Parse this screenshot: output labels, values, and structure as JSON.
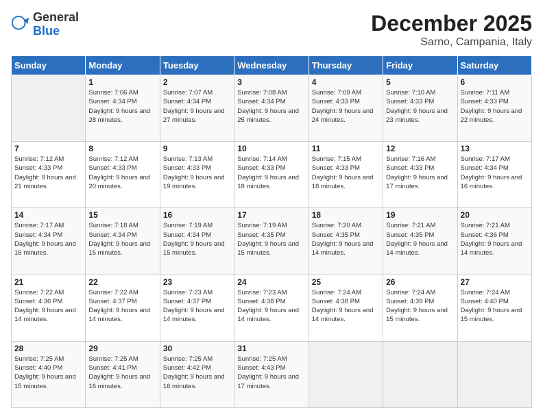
{
  "logo": {
    "general": "General",
    "blue": "Blue"
  },
  "title": "December 2025",
  "subtitle": "Sarno, Campania, Italy",
  "days_header": [
    "Sunday",
    "Monday",
    "Tuesday",
    "Wednesday",
    "Thursday",
    "Friday",
    "Saturday"
  ],
  "weeks": [
    [
      {
        "day": "",
        "sunrise": "",
        "sunset": "",
        "daylight": ""
      },
      {
        "day": "1",
        "sunrise": "Sunrise: 7:06 AM",
        "sunset": "Sunset: 4:34 PM",
        "daylight": "Daylight: 9 hours and 28 minutes."
      },
      {
        "day": "2",
        "sunrise": "Sunrise: 7:07 AM",
        "sunset": "Sunset: 4:34 PM",
        "daylight": "Daylight: 9 hours and 27 minutes."
      },
      {
        "day": "3",
        "sunrise": "Sunrise: 7:08 AM",
        "sunset": "Sunset: 4:34 PM",
        "daylight": "Daylight: 9 hours and 25 minutes."
      },
      {
        "day": "4",
        "sunrise": "Sunrise: 7:09 AM",
        "sunset": "Sunset: 4:33 PM",
        "daylight": "Daylight: 9 hours and 24 minutes."
      },
      {
        "day": "5",
        "sunrise": "Sunrise: 7:10 AM",
        "sunset": "Sunset: 4:33 PM",
        "daylight": "Daylight: 9 hours and 23 minutes."
      },
      {
        "day": "6",
        "sunrise": "Sunrise: 7:11 AM",
        "sunset": "Sunset: 4:33 PM",
        "daylight": "Daylight: 9 hours and 22 minutes."
      }
    ],
    [
      {
        "day": "7",
        "sunrise": "Sunrise: 7:12 AM",
        "sunset": "Sunset: 4:33 PM",
        "daylight": "Daylight: 9 hours and 21 minutes."
      },
      {
        "day": "8",
        "sunrise": "Sunrise: 7:12 AM",
        "sunset": "Sunset: 4:33 PM",
        "daylight": "Daylight: 9 hours and 20 minutes."
      },
      {
        "day": "9",
        "sunrise": "Sunrise: 7:13 AM",
        "sunset": "Sunset: 4:33 PM",
        "daylight": "Daylight: 9 hours and 19 minutes."
      },
      {
        "day": "10",
        "sunrise": "Sunrise: 7:14 AM",
        "sunset": "Sunset: 4:33 PM",
        "daylight": "Daylight: 9 hours and 18 minutes."
      },
      {
        "day": "11",
        "sunrise": "Sunrise: 7:15 AM",
        "sunset": "Sunset: 4:33 PM",
        "daylight": "Daylight: 9 hours and 18 minutes."
      },
      {
        "day": "12",
        "sunrise": "Sunrise: 7:16 AM",
        "sunset": "Sunset: 4:33 PM",
        "daylight": "Daylight: 9 hours and 17 minutes."
      },
      {
        "day": "13",
        "sunrise": "Sunrise: 7:17 AM",
        "sunset": "Sunset: 4:34 PM",
        "daylight": "Daylight: 9 hours and 16 minutes."
      }
    ],
    [
      {
        "day": "14",
        "sunrise": "Sunrise: 7:17 AM",
        "sunset": "Sunset: 4:34 PM",
        "daylight": "Daylight: 9 hours and 16 minutes."
      },
      {
        "day": "15",
        "sunrise": "Sunrise: 7:18 AM",
        "sunset": "Sunset: 4:34 PM",
        "daylight": "Daylight: 9 hours and 15 minutes."
      },
      {
        "day": "16",
        "sunrise": "Sunrise: 7:19 AM",
        "sunset": "Sunset: 4:34 PM",
        "daylight": "Daylight: 9 hours and 15 minutes."
      },
      {
        "day": "17",
        "sunrise": "Sunrise: 7:19 AM",
        "sunset": "Sunset: 4:35 PM",
        "daylight": "Daylight: 9 hours and 15 minutes."
      },
      {
        "day": "18",
        "sunrise": "Sunrise: 7:20 AM",
        "sunset": "Sunset: 4:35 PM",
        "daylight": "Daylight: 9 hours and 14 minutes."
      },
      {
        "day": "19",
        "sunrise": "Sunrise: 7:21 AM",
        "sunset": "Sunset: 4:35 PM",
        "daylight": "Daylight: 9 hours and 14 minutes."
      },
      {
        "day": "20",
        "sunrise": "Sunrise: 7:21 AM",
        "sunset": "Sunset: 4:36 PM",
        "daylight": "Daylight: 9 hours and 14 minutes."
      }
    ],
    [
      {
        "day": "21",
        "sunrise": "Sunrise: 7:22 AM",
        "sunset": "Sunset: 4:36 PM",
        "daylight": "Daylight: 9 hours and 14 minutes."
      },
      {
        "day": "22",
        "sunrise": "Sunrise: 7:22 AM",
        "sunset": "Sunset: 4:37 PM",
        "daylight": "Daylight: 9 hours and 14 minutes."
      },
      {
        "day": "23",
        "sunrise": "Sunrise: 7:23 AM",
        "sunset": "Sunset: 4:37 PM",
        "daylight": "Daylight: 9 hours and 14 minutes."
      },
      {
        "day": "24",
        "sunrise": "Sunrise: 7:23 AM",
        "sunset": "Sunset: 4:38 PM",
        "daylight": "Daylight: 9 hours and 14 minutes."
      },
      {
        "day": "25",
        "sunrise": "Sunrise: 7:24 AM",
        "sunset": "Sunset: 4:38 PM",
        "daylight": "Daylight: 9 hours and 14 minutes."
      },
      {
        "day": "26",
        "sunrise": "Sunrise: 7:24 AM",
        "sunset": "Sunset: 4:39 PM",
        "daylight": "Daylight: 9 hours and 15 minutes."
      },
      {
        "day": "27",
        "sunrise": "Sunrise: 7:24 AM",
        "sunset": "Sunset: 4:40 PM",
        "daylight": "Daylight: 9 hours and 15 minutes."
      }
    ],
    [
      {
        "day": "28",
        "sunrise": "Sunrise: 7:25 AM",
        "sunset": "Sunset: 4:40 PM",
        "daylight": "Daylight: 9 hours and 15 minutes."
      },
      {
        "day": "29",
        "sunrise": "Sunrise: 7:25 AM",
        "sunset": "Sunset: 4:41 PM",
        "daylight": "Daylight: 9 hours and 16 minutes."
      },
      {
        "day": "30",
        "sunrise": "Sunrise: 7:25 AM",
        "sunset": "Sunset: 4:42 PM",
        "daylight": "Daylight: 9 hours and 16 minutes."
      },
      {
        "day": "31",
        "sunrise": "Sunrise: 7:25 AM",
        "sunset": "Sunset: 4:43 PM",
        "daylight": "Daylight: 9 hours and 17 minutes."
      },
      {
        "day": "",
        "sunrise": "",
        "sunset": "",
        "daylight": ""
      },
      {
        "day": "",
        "sunrise": "",
        "sunset": "",
        "daylight": ""
      },
      {
        "day": "",
        "sunrise": "",
        "sunset": "",
        "daylight": ""
      }
    ]
  ]
}
